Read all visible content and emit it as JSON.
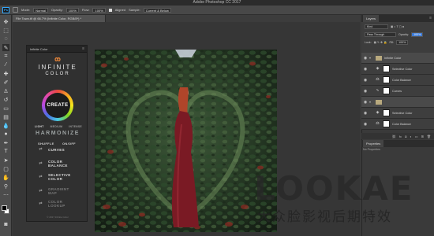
{
  "window": {
    "title": "Adobe Photoshop CC 2017"
  },
  "options_bar": {
    "app_badge": "Ps",
    "mode_label": "Mode:",
    "mode_value": "Normal",
    "opacity_label": "Opacity:",
    "opacity_value": "100%",
    "flow_label": "Flow:",
    "flow_value": "100%",
    "aligned_label": "Aligned",
    "sample_label": "Sample:",
    "sample_value": "Current & Below"
  },
  "document": {
    "tab_title": "File Town.tif @ 66.7% (Infinite Color, RGB/8*) *"
  },
  "infinite_color": {
    "panel_title": "Infinite Color",
    "brand_line1": "INFINITE",
    "brand_line2": "COLOR",
    "create_label": "CREATE",
    "modes": [
      "LIGHT",
      "MEDIUM",
      "INTENSE"
    ],
    "harmonize_label": "HARMONIZE",
    "shuffle_label": "SHUFFLE",
    "onoff_label": "ON/OFF",
    "tools": [
      {
        "icon": "curves-icon",
        "label": "CURVES",
        "enabled": true
      },
      {
        "icon": "color-balance-icon",
        "label": "COLOR BALANCE",
        "enabled": true
      },
      {
        "icon": "selective-color-icon",
        "label": "SELECTIVE COLOR",
        "enabled": true
      },
      {
        "icon": "gradient-map-icon",
        "label": "GRADIENT MAP",
        "enabled": false
      },
      {
        "icon": "color-lookup-icon",
        "label": "COLOR LOOKUP",
        "enabled": false
      }
    ],
    "footer": "© 2017 Infinite Color"
  },
  "layers_panel": {
    "tab_label": "Layers",
    "kind_label": "Kind",
    "blend_mode": "Pass Through",
    "opacity_label": "Opacity:",
    "opacity_value": "100%",
    "lock_label": "Lock:",
    "fill_label": "Fill:",
    "fill_value": "100%",
    "layers": [
      {
        "type": "group",
        "name": "Infinite Color"
      },
      {
        "type": "adjustment",
        "name": "Selective Color",
        "icon": "selective-color-icon"
      },
      {
        "type": "adjustment",
        "name": "Color Balance",
        "icon": "color-balance-icon"
      },
      {
        "type": "adjustment",
        "name": "Curves",
        "icon": "curves-icon"
      },
      {
        "type": "group",
        "name": ""
      },
      {
        "type": "adjustment",
        "name": "Selective Color",
        "icon": "selective-color-icon"
      },
      {
        "type": "adjustment",
        "name": "Color Balance",
        "icon": "color-balance-icon"
      }
    ]
  },
  "properties_panel": {
    "tab_label": "Properties",
    "content": "No Properties"
  },
  "watermark": {
    "latin": "LOOKAE",
    "chinese": "大众脸影视后期特效"
  }
}
